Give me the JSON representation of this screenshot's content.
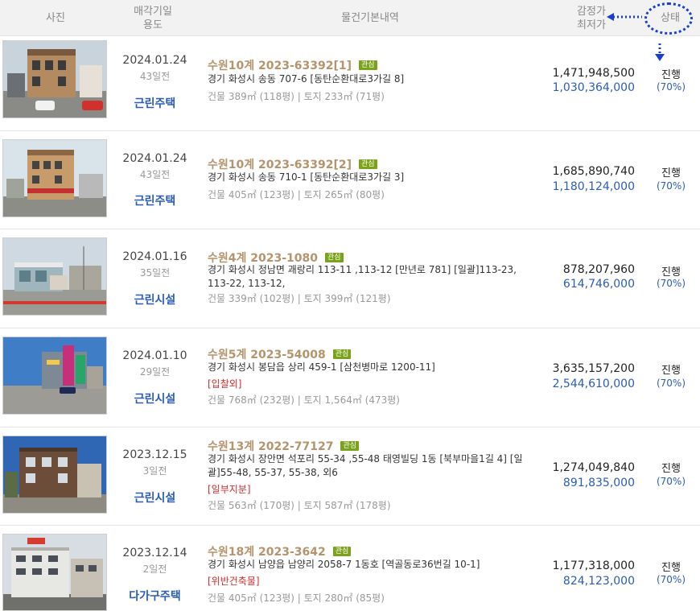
{
  "header": {
    "photo": "사진",
    "date_line1": "매각기일",
    "date_line2": "용도",
    "info": "물건기본내역",
    "price_line1": "감정가",
    "price_line2": "최저가",
    "status": "상태"
  },
  "badge_label": "관심",
  "listings": [
    {
      "date": "2024.01.24",
      "ago": "43일전",
      "usage": "근린주택",
      "case": "수원10계 2023-63392[1]",
      "address": "경기 화성시 송동 707-6 [동탄순환대로3가길 8]",
      "flag": "",
      "area": "건물 389㎡ (118평)  |  토지 233㎡ (71평)",
      "appraisal": "1,471,948,500",
      "min_price": "1,030,364,000",
      "status": "진행",
      "ratio": "(70%)"
    },
    {
      "date": "2024.01.24",
      "ago": "43일전",
      "usage": "근린주택",
      "case": "수원10계 2023-63392[2]",
      "address": "경기 화성시 송동 710-1 [동탄순환대로3가길 3]",
      "flag": "",
      "area": "건물 405㎡ (123평)  |  토지 265㎡ (80평)",
      "appraisal": "1,685,890,740",
      "min_price": "1,180,124,000",
      "status": "진행",
      "ratio": "(70%)"
    },
    {
      "date": "2024.01.16",
      "ago": "35일전",
      "usage": "근린시설",
      "case": "수원4계 2023-1080",
      "address": "경기 화성시 정남면 괘랑리 113-11 ,113-12 [만년로 781]  [일괄]113-23, 113-22, 113-12,",
      "flag": "",
      "area": "건물 339㎡ (102평)  |  토지 399㎡ (121평)",
      "appraisal": "878,207,960",
      "min_price": "614,746,000",
      "status": "진행",
      "ratio": "(70%)"
    },
    {
      "date": "2024.01.10",
      "ago": "29일전",
      "usage": "근린시설",
      "case": "수원5계 2023-54008",
      "address": "경기 화성시 봉담읍 상리 459-1 [삼천병마로 1200-11]",
      "flag": "[입찰외]",
      "area": "건물 768㎡ (232평)  |  토지 1,564㎡ (473평)",
      "appraisal": "3,635,157,200",
      "min_price": "2,544,610,000",
      "status": "진행",
      "ratio": "(70%)"
    },
    {
      "date": "2023.12.15",
      "ago": "3일전",
      "usage": "근린시설",
      "case": "수원13계 2022-77127",
      "address": "경기 화성시 장안면 석포리 55-34 ,55-48 태영빌딩 1동 [북부마을1길 4]  [일괄]55-48, 55-37, 55-38, 외6",
      "flag": "[일부지분]",
      "area": "건물 563㎡ (170평)  |  토지 587㎡ (178평)",
      "appraisal": "1,274,049,840",
      "min_price": "891,835,000",
      "status": "진행",
      "ratio": "(70%)"
    },
    {
      "date": "2023.12.14",
      "ago": "2일전",
      "usage": "다가구주택",
      "case": "수원18계 2023-3642",
      "address": "경기 화성시 남양읍 남양리 2058-7 1동호 [역골동로36번길 10-1]",
      "flag": "[위반건축물]",
      "area": "건물 405㎡ (123평)  |  토지 280㎡ (85평)",
      "appraisal": "1,177,318,000",
      "min_price": "824,123,000",
      "status": "진행",
      "ratio": "(70%)"
    }
  ]
}
